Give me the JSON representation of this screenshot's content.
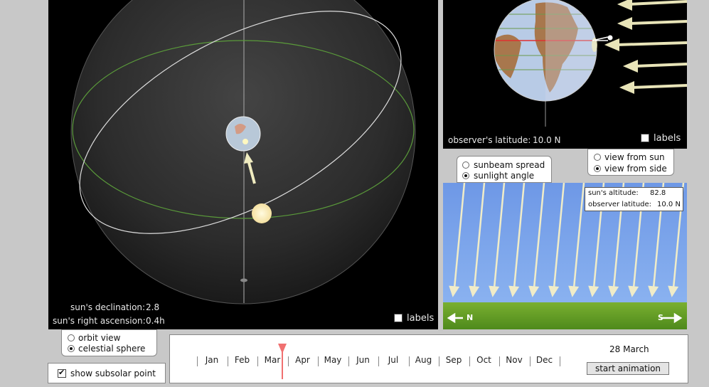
{
  "celestial": {
    "declination_label": "sun's declination:",
    "declination_value": "2.8",
    "ra_label": "sun's right ascension:",
    "ra_value": "0.4h",
    "labels_checkbox": "labels"
  },
  "earth_view": {
    "latitude_label": "observer's latitude:",
    "latitude_value": "10.0 N",
    "labels_checkbox": "labels"
  },
  "view_options": {
    "from_sun": "view from sun",
    "from_side": "view from side",
    "selected": "view from side"
  },
  "mode_options": {
    "spread": "sunbeam spread",
    "angle": "sunlight angle",
    "selected": "sunlight angle"
  },
  "sunlight": {
    "altitude_label": "sun's altitude:",
    "altitude_value": "82.8",
    "observer_label": "observer latitude:",
    "observer_value": "10.0 N",
    "north": "N",
    "south": "S",
    "colors": {
      "sky": "#7aa4ea",
      "ground": "#5f9a24"
    }
  },
  "sphere_options": {
    "orbit": "orbit view",
    "celestial": "celestial sphere",
    "selected": "celestial sphere"
  },
  "subsolar": {
    "label": "show subsolar point",
    "checked": true
  },
  "timeline": {
    "months": [
      "Jan",
      "Feb",
      "Mar",
      "Apr",
      "May",
      "Jun",
      "Jul",
      "Aug",
      "Sep",
      "Oct",
      "Nov",
      "Dec"
    ],
    "date": "28 March",
    "start_button": "start animation",
    "marker_color": "#f07070"
  }
}
